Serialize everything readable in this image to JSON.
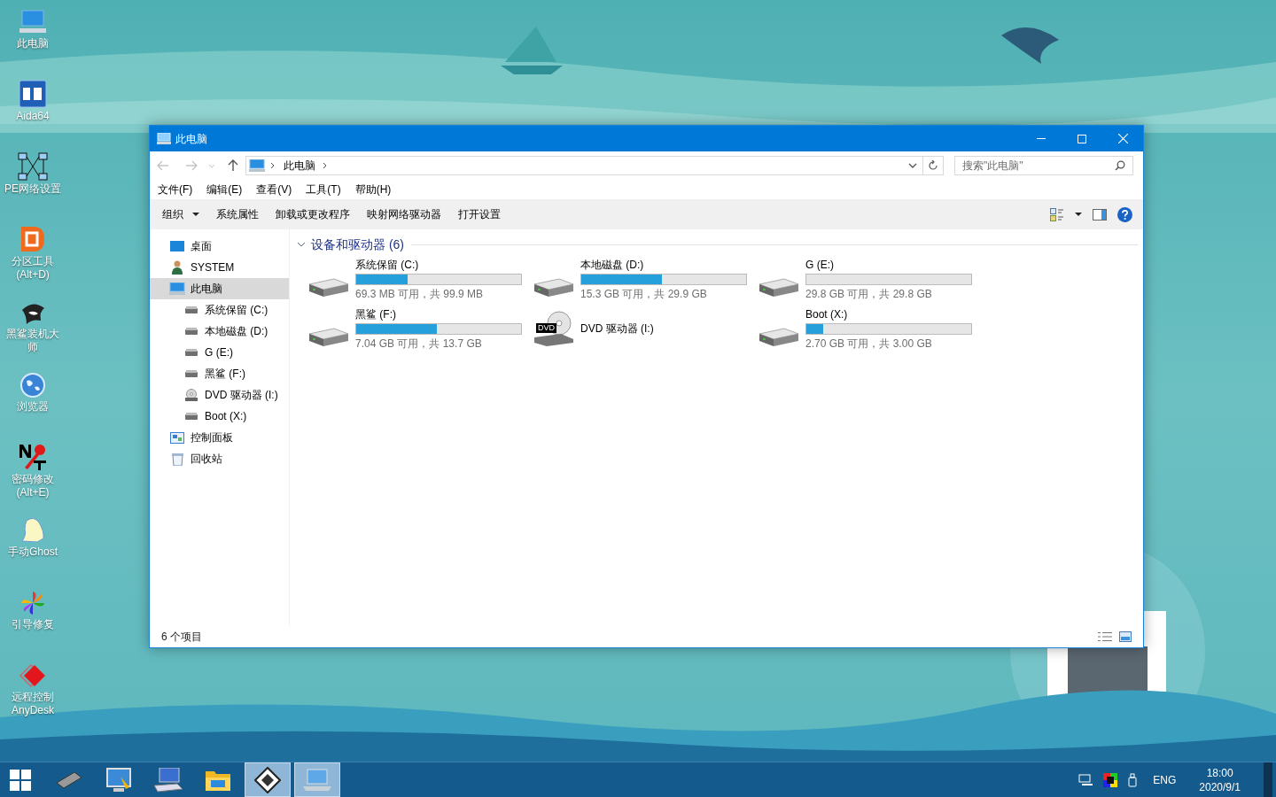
{
  "desktop_icons": [
    {
      "kind": "pc",
      "label": "此电脑"
    },
    {
      "kind": "aida",
      "label": "Aida64"
    },
    {
      "kind": "network",
      "label": "PE网络设置"
    },
    {
      "kind": "partition",
      "label": "分区工具 (Alt+D)"
    },
    {
      "kind": "shark",
      "label": "黑鲨装机大师"
    },
    {
      "kind": "globe",
      "label": "浏览器"
    },
    {
      "kind": "key",
      "label": "密码修改 (Alt+E)"
    },
    {
      "kind": "ghost",
      "label": "手动Ghost"
    },
    {
      "kind": "flower",
      "label": "引导修复"
    },
    {
      "kind": "anydesk",
      "label": "远程控制 AnyDesk"
    }
  ],
  "window": {
    "title": "此电脑",
    "address": {
      "path": "此电脑"
    },
    "search": {
      "placeholder": "搜索\"此电脑\""
    },
    "menu": [
      "文件(F)",
      "编辑(E)",
      "查看(V)",
      "工具(T)",
      "帮助(H)"
    ],
    "toolbar": [
      {
        "label": "组织",
        "dropdown": true
      },
      {
        "label": "系统属性",
        "dropdown": false
      },
      {
        "label": "卸载或更改程序",
        "dropdown": false
      },
      {
        "label": "映射网络驱动器",
        "dropdown": false
      },
      {
        "label": "打开设置",
        "dropdown": false
      }
    ],
    "nav": [
      {
        "kind": "desktop",
        "label": "桌面",
        "selected": false
      },
      {
        "kind": "user",
        "label": "SYSTEM",
        "selected": false
      },
      {
        "kind": "pc",
        "label": "此电脑",
        "selected": true,
        "children": [
          {
            "kind": "drive",
            "label": "系统保留 (C:)",
            "selected": false
          },
          {
            "kind": "drive",
            "label": "本地磁盘 (D:)",
            "selected": false
          },
          {
            "kind": "drive",
            "label": "G (E:)",
            "selected": false
          },
          {
            "kind": "drive",
            "label": "黑鲨 (F:)",
            "selected": false
          },
          {
            "kind": "dvd",
            "label": "DVD 驱动器 (I:)",
            "selected": false
          },
          {
            "kind": "drive",
            "label": "Boot (X:)",
            "selected": false
          }
        ]
      },
      {
        "kind": "control",
        "label": "控制面板",
        "selected": false
      },
      {
        "kind": "recycle",
        "label": "回收站",
        "selected": false
      }
    ],
    "group": {
      "title": "设备和驱动器 (6)",
      "expanded": true
    },
    "drives": [
      {
        "kind": "disk",
        "name": "系统保留 (C:)",
        "level": 0.31,
        "reading": "69.3 MB 可用，共 99.9 MB"
      },
      {
        "kind": "disk",
        "name": "本地磁盘 (D:)",
        "level": 0.49,
        "reading": "15.3 GB 可用，共 29.9 GB"
      },
      {
        "kind": "disk",
        "name": "G (E:)",
        "level": 0,
        "reading": "29.8 GB 可用，共 29.8 GB"
      },
      {
        "kind": "disk",
        "name": "黑鲨 (F:)",
        "level": 0.49,
        "reading": "7.04 GB 可用，共 13.7 GB"
      },
      {
        "kind": "dvd",
        "name": "DVD 驱动器 (I:)",
        "badge": "DVD"
      },
      {
        "kind": "disk",
        "name": "Boot (X:)",
        "level": 0.1,
        "reading": "2.70 GB 可用，共 3.00 GB"
      }
    ],
    "status": "6 个项目"
  },
  "taskbar": {
    "items": [
      {
        "kind": "chip",
        "selected": false
      },
      {
        "kind": "tools",
        "selected": false
      },
      {
        "kind": "keyboard",
        "selected": false
      },
      {
        "kind": "folder",
        "selected": false
      },
      {
        "kind": "floppy",
        "selected": true
      },
      {
        "kind": "laptop",
        "selected": true
      }
    ],
    "language": "ENG",
    "time": "18:00",
    "date": "2020/9/1"
  }
}
